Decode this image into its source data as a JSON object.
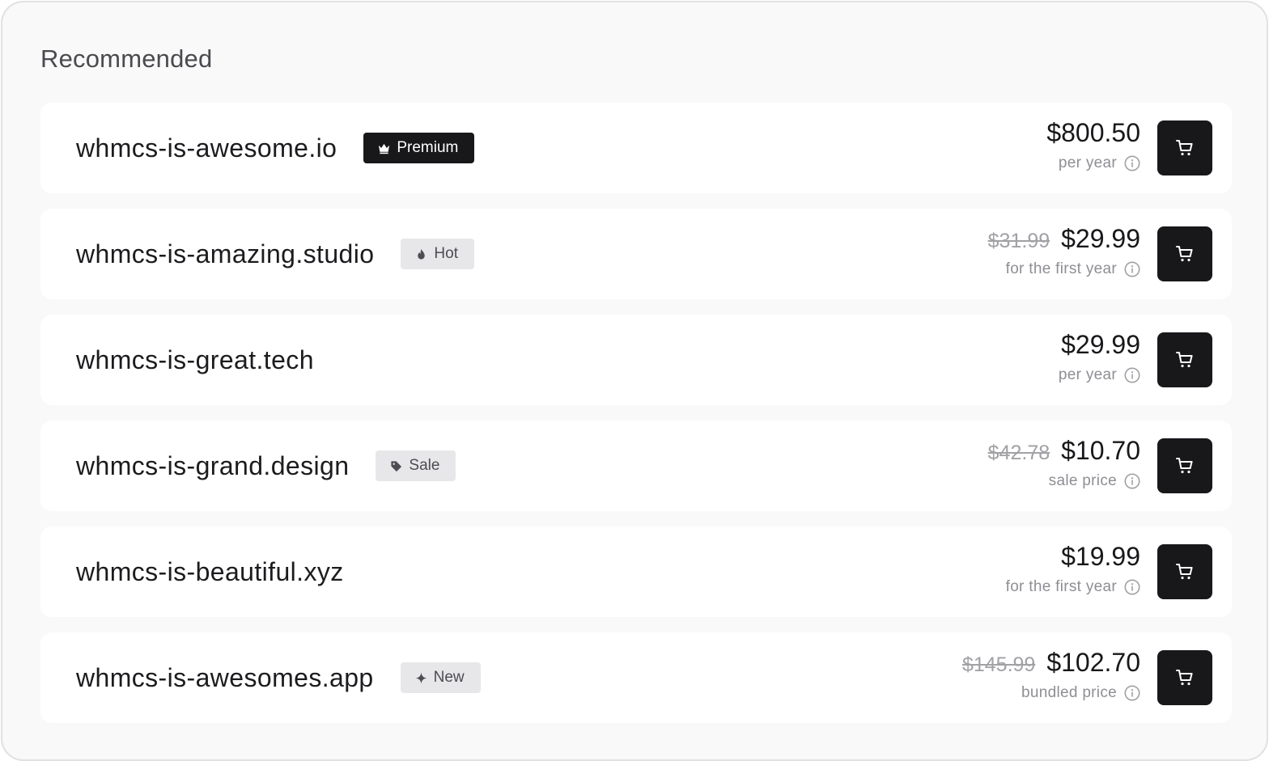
{
  "section": {
    "title": "Recommended"
  },
  "results": [
    {
      "domain": "whmcs-is-awesome.io",
      "badge": {
        "label": "Premium",
        "style": "dark",
        "icon": "crown-icon"
      },
      "old_price": "",
      "price": "$800.50",
      "note": "per year"
    },
    {
      "domain": "whmcs-is-amazing.studio",
      "badge": {
        "label": "Hot",
        "style": "light",
        "icon": "flame-icon"
      },
      "old_price": "$31.99",
      "price": "$29.99",
      "note": "for the first year"
    },
    {
      "domain": "whmcs-is-great.tech",
      "badge": null,
      "old_price": "",
      "price": "$29.99",
      "note": "per year"
    },
    {
      "domain": "whmcs-is-grand.design",
      "badge": {
        "label": "Sale",
        "style": "light",
        "icon": "tag-icon"
      },
      "old_price": "$42.78",
      "price": "$10.70",
      "note": "sale price"
    },
    {
      "domain": "whmcs-is-beautiful.xyz",
      "badge": null,
      "old_price": "",
      "price": "$19.99",
      "note": "for the first year"
    },
    {
      "domain": "whmcs-is-awesomes.app",
      "badge": {
        "label": "New",
        "style": "light",
        "icon": "sparkle-icon"
      },
      "old_price": "$145.99",
      "price": "$102.70",
      "note": "bundled price"
    }
  ],
  "icons": {
    "cart": "cart-icon",
    "info": "info-icon"
  },
  "colors": {
    "accent": "#18181b",
    "panel_bg": "#f9f9f9",
    "card_bg": "#ffffff",
    "muted_text": "#8e8e94",
    "badge_light_bg": "#e7e7e9"
  }
}
